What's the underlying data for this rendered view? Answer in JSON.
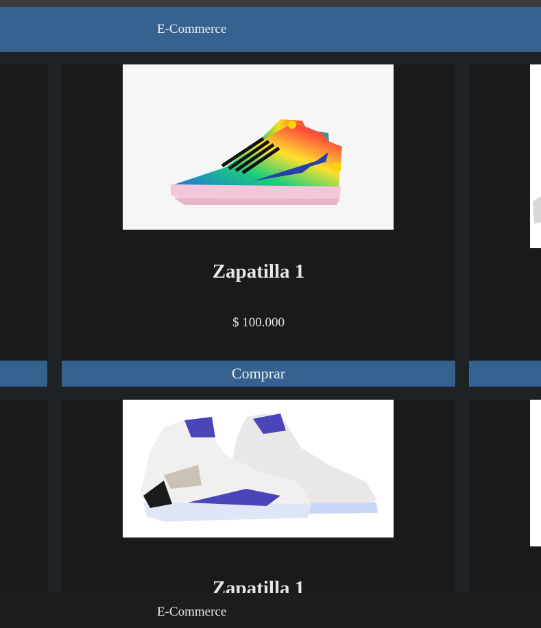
{
  "header": {
    "brand": "E-Commerce"
  },
  "products": [
    {
      "title": "Zapatilla 1",
      "price": "$ 100.000",
      "buy_label": "Comprar",
      "image": "sneaker-multicolor-image"
    },
    {
      "title": "Zapatilla 1",
      "image": "sneaker-white-purple-image"
    }
  ],
  "footer": {
    "brand": "E-Commerce"
  },
  "colors": {
    "accent": "#35618f",
    "background": "#1b1d1f"
  }
}
